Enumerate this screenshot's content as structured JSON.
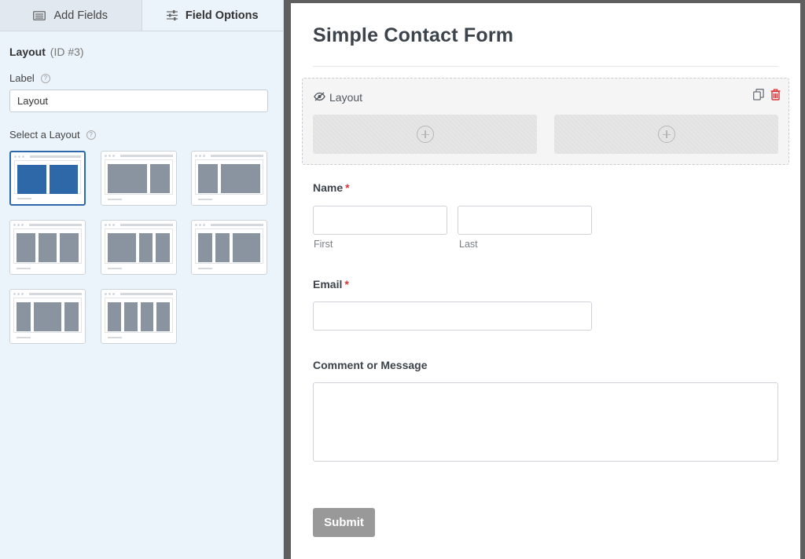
{
  "sidebar": {
    "tabs": [
      {
        "label": "Add Fields",
        "icon": "list-icon"
      },
      {
        "label": "Field Options",
        "icon": "sliders-icon"
      }
    ],
    "field": {
      "name": "Layout",
      "id": "(ID #3)"
    },
    "label_field": {
      "label": "Label",
      "value": "Layout"
    },
    "layout_select": {
      "label": "Select a Layout",
      "selected_index": 0,
      "options": [
        {
          "name": "layout-50-50",
          "columns": [
            1,
            1
          ]
        },
        {
          "name": "layout-67-33",
          "columns": [
            2,
            1
          ]
        },
        {
          "name": "layout-33-67",
          "columns": [
            1,
            2
          ]
        },
        {
          "name": "layout-33-33-33",
          "columns": [
            1,
            1,
            1
          ]
        },
        {
          "name": "layout-50-25-25",
          "columns": [
            2,
            1,
            1
          ]
        },
        {
          "name": "layout-25-25-50",
          "columns": [
            1,
            1,
            2
          ]
        },
        {
          "name": "layout-25-50-25",
          "columns": [
            1,
            2,
            1
          ]
        },
        {
          "name": "layout-25-25-25-25",
          "columns": [
            1,
            1,
            1,
            1
          ]
        }
      ]
    }
  },
  "form": {
    "title": "Simple Contact Form",
    "layout_block": {
      "label": "Layout"
    },
    "name_field": {
      "label": "Name",
      "required_mark": "*",
      "first_sublabel": "First",
      "last_sublabel": "Last"
    },
    "email_field": {
      "label": "Email",
      "required_mark": "*"
    },
    "comment_field": {
      "label": "Comment or Message"
    },
    "submit_label": "Submit"
  },
  "colors": {
    "selected_accent": "#2e68a8",
    "required": "#d63638",
    "delete": "#d63638",
    "submit_bg": "#999999"
  }
}
